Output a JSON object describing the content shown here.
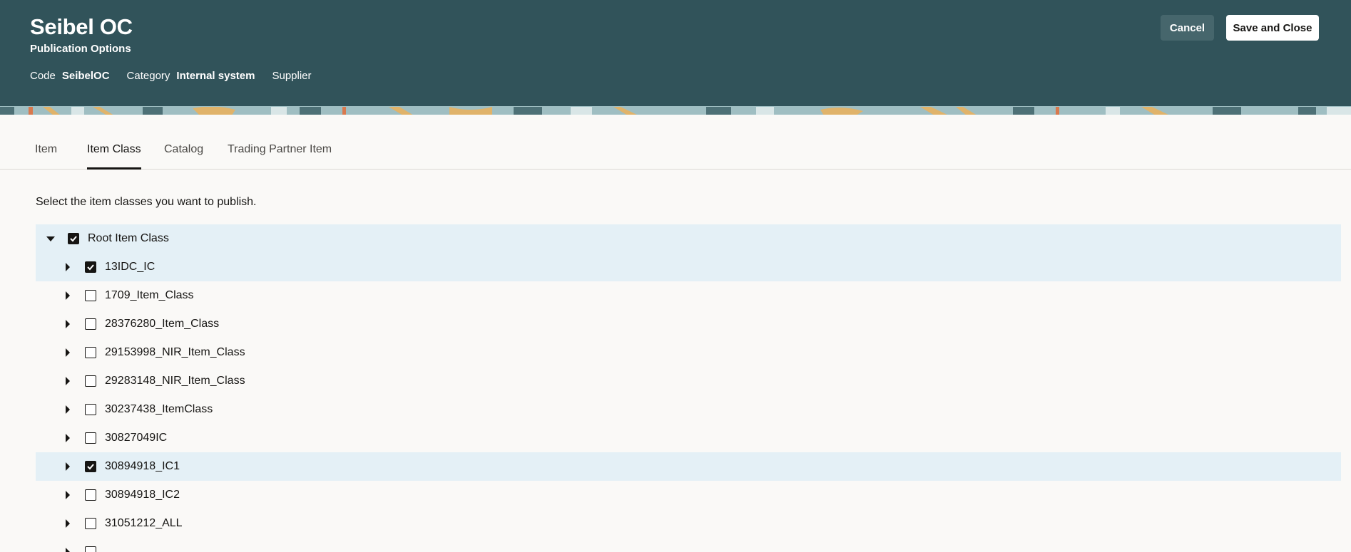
{
  "header": {
    "title": "Seibel OC",
    "subtitle": "Publication Options",
    "code_label": "Code",
    "code_value": "SeibelOC",
    "category_label": "Category",
    "category_value": "Internal system",
    "type_value": "Supplier",
    "cancel_label": "Cancel",
    "save_label": "Save and Close",
    "brand_color": "#31535a"
  },
  "tabs": [
    {
      "label": "Item",
      "active": false
    },
    {
      "label": "Item Class",
      "active": true
    },
    {
      "label": "Catalog",
      "active": false
    },
    {
      "label": "Trading Partner Item",
      "active": false
    }
  ],
  "main": {
    "instructions": "Select the item classes you want to publish."
  },
  "tree": {
    "root": {
      "label": "Root Item Class",
      "checked": true,
      "expanded": true
    },
    "children": [
      {
        "label": "13IDC_IC",
        "checked": true
      },
      {
        "label": "1709_Item_Class",
        "checked": false
      },
      {
        "label": "28376280_Item_Class",
        "checked": false
      },
      {
        "label": "29153998_NIR_Item_Class",
        "checked": false
      },
      {
        "label": "29283148_NIR_Item_Class",
        "checked": false
      },
      {
        "label": "30237438_ItemClass",
        "checked": false
      },
      {
        "label": "30827049IC",
        "checked": false
      },
      {
        "label": "30894918_IC1",
        "checked": true
      },
      {
        "label": "30894918_IC2",
        "checked": false
      },
      {
        "label": "31051212_ALL",
        "checked": false
      }
    ]
  }
}
